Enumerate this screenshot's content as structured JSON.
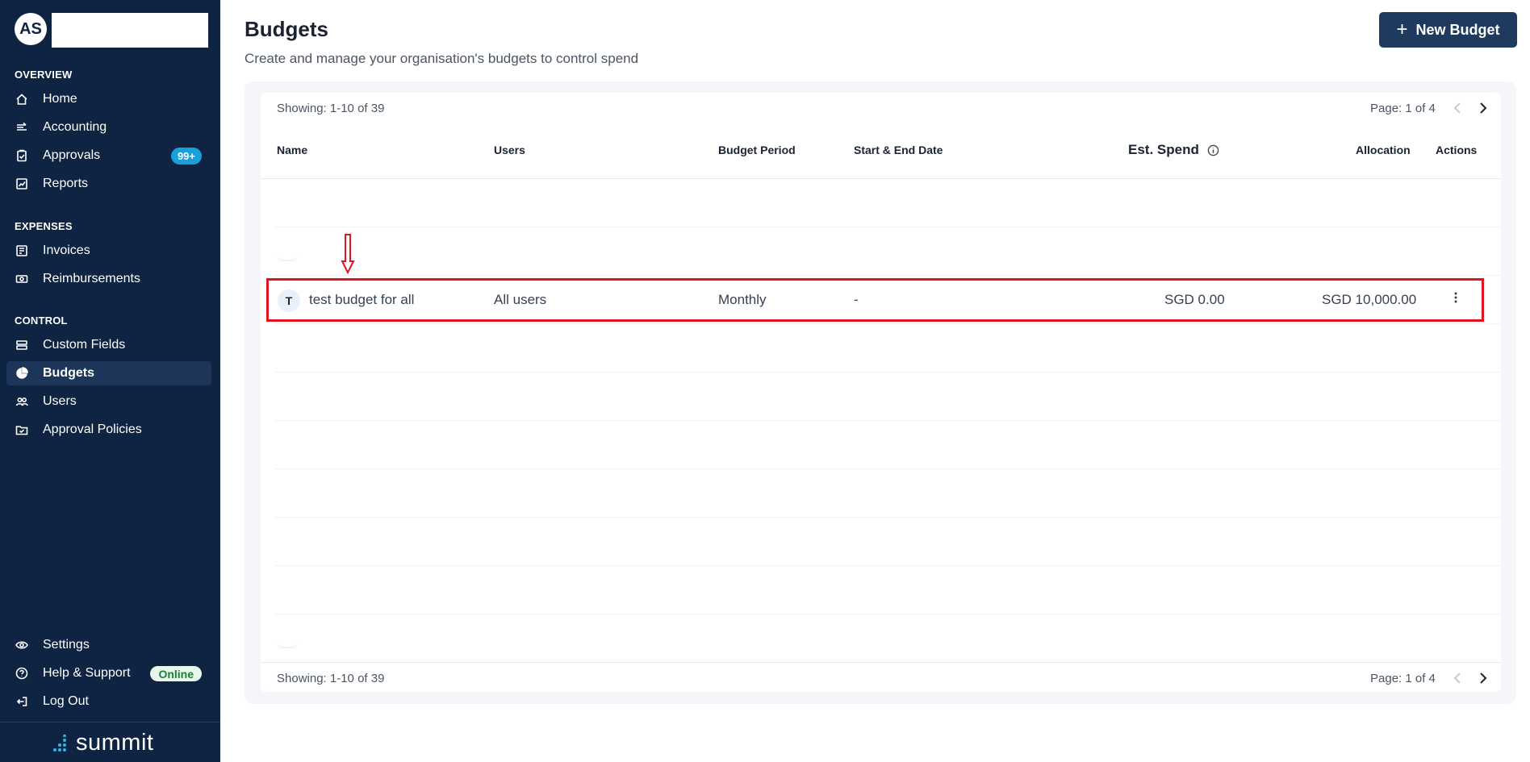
{
  "sidebar": {
    "avatar_initials": "AS",
    "sections": {
      "overview": "OVERVIEW",
      "expenses": "EXPENSES",
      "control": "CONTROL"
    },
    "items": {
      "home": "Home",
      "accounting": "Accounting",
      "approvals": "Approvals",
      "approvals_badge": "99+",
      "reports": "Reports",
      "invoices": "Invoices",
      "reimbursements": "Reimbursements",
      "custom_fields": "Custom Fields",
      "budgets": "Budgets",
      "users": "Users",
      "approval_policies": "Approval Policies",
      "settings": "Settings",
      "help_support": "Help & Support",
      "online_badge": "Online",
      "log_out": "Log Out"
    },
    "brand": "summit"
  },
  "header": {
    "title": "Budgets",
    "subtitle": "Create and manage your organisation's budgets to control spend",
    "new_button": "New Budget"
  },
  "table": {
    "showing": "Showing: 1-10 of 39",
    "page": "Page: 1 of 4",
    "columns": {
      "name": "Name",
      "users": "Users",
      "period": "Budget Period",
      "dates": "Start & End Date",
      "est_spend": "Est. Spend",
      "allocation": "Allocation",
      "actions": "Actions"
    },
    "rows": [
      {
        "initial": "T",
        "name": "test budget for all",
        "users": "All users",
        "period": "Monthly",
        "dates": "-",
        "est_spend": "SGD 0.00",
        "allocation": "SGD 10,000.00"
      }
    ]
  },
  "colors": {
    "sidebar_bg": "#0e2442",
    "primary_button": "#1f3a5f",
    "badge_blue": "#19a0da",
    "highlight_red": "#e0141e"
  }
}
